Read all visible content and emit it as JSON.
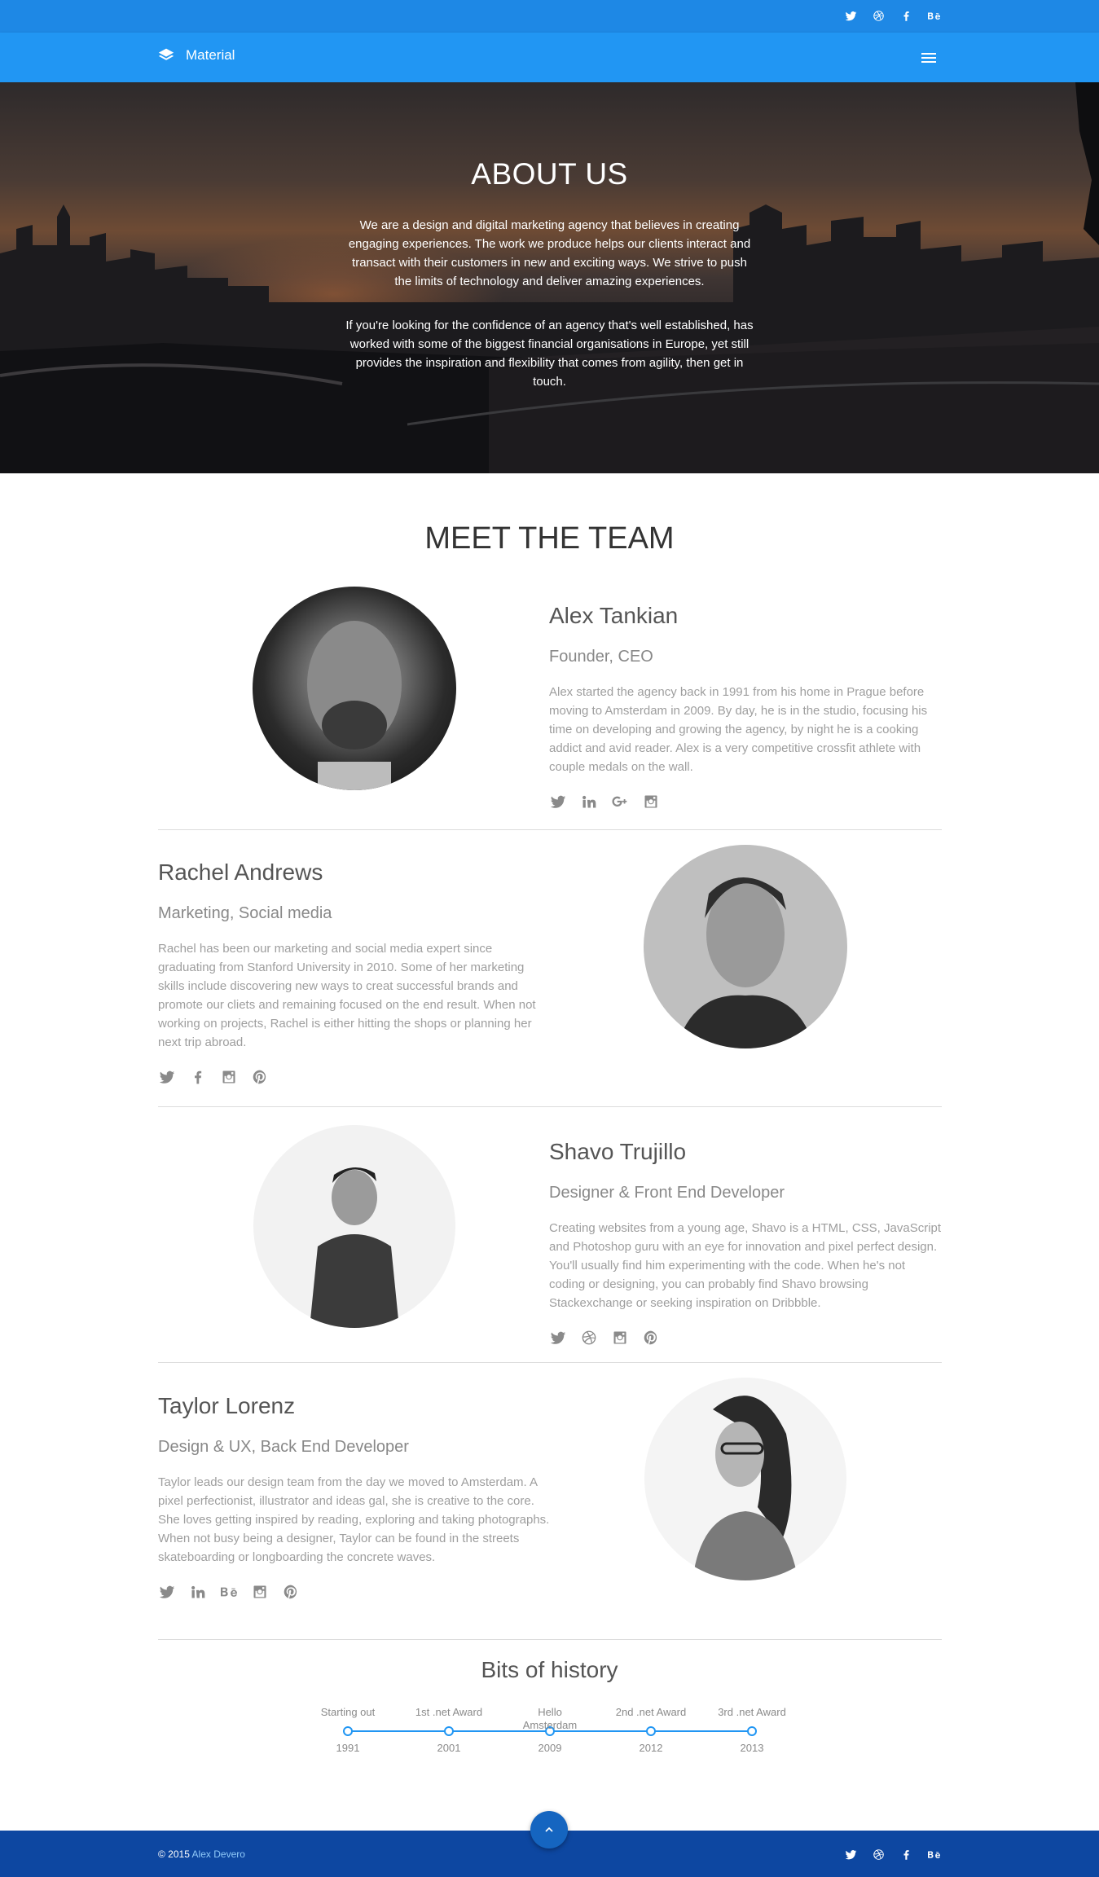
{
  "brand": {
    "name": "Material"
  },
  "top_social": [
    "twitter-icon",
    "dribbble-icon",
    "facebook-icon",
    "behance-icon"
  ],
  "hero": {
    "title": "ABOUT US",
    "paragraph1": "We are a design and digital marketing agency that believes in creating engaging experiences. The work we produce helps our clients interact and transact with their customers in new and exciting ways. We strive to push the limits of technology and deliver amazing experiences.",
    "paragraph2": "If you're looking for the confidence of an agency that's well established, has worked with some of the biggest financial organisations in Europe, yet still provides the inspiration and flexibility that comes from agility, then get in touch."
  },
  "team": {
    "title": "MEET THE TEAM",
    "members": [
      {
        "name": "Alex Tankian",
        "role": "Founder, CEO",
        "bio": "Alex started the agency back in 1991 from his home in Prague before moving to Amsterdam in 2009. By day, he is in the studio, focusing his time on developing and growing the agency, by night he is a cooking addict and avid reader. Alex is a very competitive crossfit athlete with couple medals on the wall.",
        "social": [
          "twitter-icon",
          "linkedin-icon",
          "google-plus-icon",
          "instagram-icon"
        ]
      },
      {
        "name": "Rachel Andrews",
        "role": "Marketing, Social media",
        "bio": "Rachel has been our marketing and social media expert since graduating from Stanford University in 2010. Some of her marketing skills include discovering new ways to creat successful brands and promote our cliets and remaining focused on the end result. When not working on projects, Rachel is either hitting the shops or planning her next trip abroad.",
        "social": [
          "twitter-icon",
          "facebook-icon",
          "instagram-icon",
          "pinterest-icon"
        ]
      },
      {
        "name": "Shavo Trujillo",
        "role": "Designer & Front End Developer",
        "bio": "Creating websites from a young age, Shavo is a HTML, CSS, JavaScript and Photoshop guru with an eye for innovation and pixel perfect design. You'll usually find him experimenting with the code. When he's not coding or designing, you can probably find Shavo browsing Stackexchange or seeking inspiration on Dribbble.",
        "social": [
          "twitter-icon",
          "dribbble-icon",
          "instagram-icon",
          "pinterest-icon"
        ]
      },
      {
        "name": "Taylor Lorenz",
        "role": "Design & UX, Back End Developer",
        "bio": "Taylor leads our design team from the day we moved to Amsterdam. A pixel perfectionist, illustrator and ideas gal, she is creative to the core. She loves getting inspired by reading, exploring and taking photographs. When not busy being a designer, Taylor can be found in the streets skateboarding or longboarding the concrete waves.",
        "social": [
          "twitter-icon",
          "linkedin-icon",
          "behance-icon",
          "instagram-icon",
          "pinterest-icon"
        ]
      }
    ]
  },
  "history": {
    "title": "Bits of history",
    "events": [
      {
        "label": "Starting out",
        "year": "1991"
      },
      {
        "label": "1st .net Award",
        "year": "2001"
      },
      {
        "label": "Hello Amsterdam",
        "year": "2009"
      },
      {
        "label": "2nd .net Award",
        "year": "2012"
      },
      {
        "label": "3rd .net Award",
        "year": "2013"
      }
    ]
  },
  "footer": {
    "copyright": "© 2015",
    "author": "Alex Devero"
  },
  "colors": {
    "primary": "#2196f3",
    "topbar": "#1e88e5",
    "footer": "#0d47a1"
  }
}
